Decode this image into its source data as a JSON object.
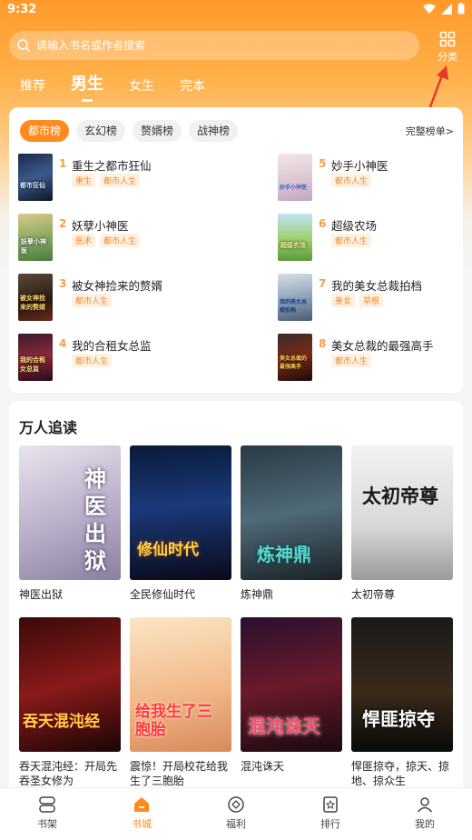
{
  "status": {
    "time": "9:32"
  },
  "search": {
    "placeholder": "请输入书名或作者搜索"
  },
  "category": {
    "label": "分类"
  },
  "top_tabs": [
    {
      "label": "推荐",
      "active": false
    },
    {
      "label": "男生",
      "active": true
    },
    {
      "label": "女生",
      "active": false
    },
    {
      "label": "完本",
      "active": false
    }
  ],
  "rank": {
    "tabs": [
      "都市榜",
      "玄幻榜",
      "赘婿榜",
      "战神榜"
    ],
    "active_tab": "都市榜",
    "full_list_label": "完整榜单>",
    "items": [
      {
        "num": "1",
        "title": "重生之都市狂仙",
        "tags": [
          "重生",
          "都市人生"
        ],
        "cover_text": "都市狂仙"
      },
      {
        "num": "2",
        "title": "妖孽小神医",
        "tags": [
          "医术",
          "都市人生"
        ],
        "cover_text": "妖孽小神医"
      },
      {
        "num": "3",
        "title": "被女神捡来的赘婿",
        "tags": [
          "都市人生"
        ],
        "cover_text": "被女神捡来的赘婿"
      },
      {
        "num": "4",
        "title": "我的合租女总监",
        "tags": [
          "都市人生"
        ],
        "cover_text": "我的合租女总监"
      },
      {
        "num": "5",
        "title": "妙手小神医",
        "tags": [
          "都市人生"
        ],
        "cover_text": "妙手小神医"
      },
      {
        "num": "6",
        "title": "超级农场",
        "tags": [
          "都市人生"
        ],
        "cover_text": "超级农场"
      },
      {
        "num": "7",
        "title": "我的美女总裁拍档",
        "tags": [
          "美女",
          "草根"
        ],
        "cover_text": "我的美女总裁拍档"
      },
      {
        "num": "8",
        "title": "美女总裁的最强高手",
        "tags": [
          "都市人生"
        ],
        "cover_text": "美女总裁的最强高手"
      }
    ]
  },
  "trending": {
    "title": "万人追读",
    "books": [
      {
        "name": "神医出狱",
        "cover_text": "神医出狱"
      },
      {
        "name": "全民修仙时代",
        "cover_text": "修仙时代"
      },
      {
        "name": "炼神鼎",
        "cover_text": "炼神鼎"
      },
      {
        "name": "太初帝尊",
        "cover_text": "太初帝尊"
      },
      {
        "name": "吞天混沌经：开局先吞圣女修为",
        "cover_text": "吞天混沌经"
      },
      {
        "name": "震惊！开局校花给我生了三胞胎",
        "cover_text": "给我生了三胞胎"
      },
      {
        "name": "混沌诛天",
        "cover_text": "混沌诛天"
      },
      {
        "name": "悍匪掠夺，掠天、掠地、掠众生",
        "cover_text": "悍匪掠夺"
      }
    ]
  },
  "nav": [
    {
      "label": "书架",
      "icon": "bookshelf-icon",
      "active": false
    },
    {
      "label": "书城",
      "icon": "home-icon",
      "active": true
    },
    {
      "label": "福利",
      "icon": "gift-icon",
      "active": false
    },
    {
      "label": "排行",
      "icon": "ranking-icon",
      "active": false
    },
    {
      "label": "我的",
      "icon": "profile-icon",
      "active": false
    }
  ],
  "colors": {
    "accent": "#ff8b1f",
    "tag_text": "#f08a2a",
    "annotation": "#e23b2b"
  }
}
